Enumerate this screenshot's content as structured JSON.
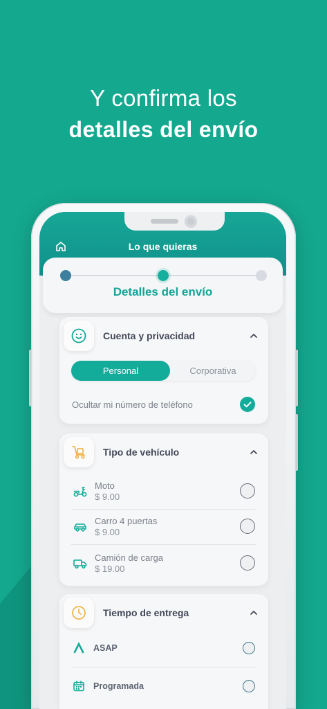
{
  "hero": {
    "line1": "Y confirma los",
    "line2": "detalles del envío"
  },
  "app_header": {
    "title": "Lo que quieras",
    "left_icon": "home-icon"
  },
  "stepper": {
    "steps": [
      {
        "completed": true,
        "current": false
      },
      {
        "completed": false,
        "current": true
      },
      {
        "completed": false,
        "current": false
      }
    ],
    "current_label": "Detalles del envío"
  },
  "account": {
    "title": "Cuenta y privacidad",
    "icon": "smiley-icon",
    "expanded": true,
    "tabs": [
      {
        "label": "Personal",
        "active": true
      },
      {
        "label": "Corporativa",
        "active": false
      }
    ],
    "hide_phone": {
      "label": "Ocultar mi número de teléfono",
      "checked": true
    }
  },
  "vehicle": {
    "title": "Tipo de vehículo",
    "icon": "hand-truck-icon",
    "expanded": true,
    "options": [
      {
        "name": "Moto",
        "price": "$ 9.00",
        "icon": "scooter-icon",
        "selected": false
      },
      {
        "name": "Carro 4 puertas",
        "price": "$ 9.00",
        "icon": "car-icon",
        "selected": false
      },
      {
        "name": "Camión de carga",
        "price": "$ 19.00",
        "icon": "truck-icon",
        "selected": false
      }
    ]
  },
  "delivery": {
    "title": "Tiempo de entrega",
    "icon": "clock-icon",
    "expanded": true,
    "options": [
      {
        "name": "ASAP",
        "icon": "asap-icon",
        "selected": false
      },
      {
        "name": "Programada",
        "icon": "calendar-icon",
        "selected": false
      }
    ]
  },
  "colors": {
    "background": "#14a88f",
    "accent": "#13ab9a",
    "step_done": "#3d7f9c",
    "step_pending": "#d7dae3",
    "icon_yellow": "#f0b54a"
  }
}
